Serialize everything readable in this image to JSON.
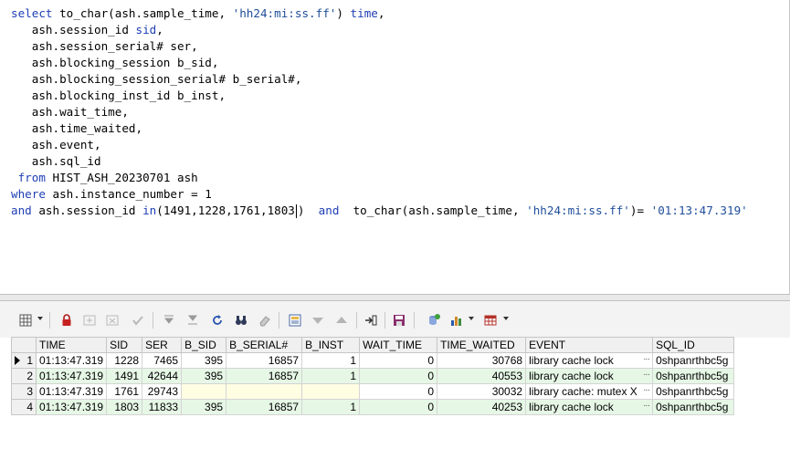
{
  "editor": {
    "lines": [
      {
        "parts": [
          {
            "t": "select",
            "c": "kw"
          },
          {
            "t": " to_char(ash.sample_time, "
          },
          {
            "t": "'hh24:mi:ss.ff'",
            "c": "str"
          },
          {
            "t": ") "
          },
          {
            "t": "time",
            "c": "kw"
          },
          {
            "t": ","
          }
        ]
      },
      {
        "parts": [
          {
            "t": "   ash.session_id "
          },
          {
            "t": "sid",
            "c": "kw"
          },
          {
            "t": ","
          }
        ]
      },
      {
        "parts": [
          {
            "t": "   ash.session_serial# ser,"
          }
        ]
      },
      {
        "parts": [
          {
            "t": "   ash.blocking_session b_sid,"
          }
        ]
      },
      {
        "parts": [
          {
            "t": "   ash.blocking_session_serial# b_serial#,"
          }
        ]
      },
      {
        "parts": [
          {
            "t": "   ash.blocking_inst_id b_inst,"
          }
        ]
      },
      {
        "parts": [
          {
            "t": "   ash.wait_time,"
          }
        ]
      },
      {
        "parts": [
          {
            "t": "   ash.time_waited,"
          }
        ]
      },
      {
        "parts": [
          {
            "t": "   ash.event,"
          }
        ]
      },
      {
        "parts": [
          {
            "t": "   ash.sql_id"
          }
        ]
      },
      {
        "parts": [
          {
            "t": " "
          },
          {
            "t": "from",
            "c": "kw"
          },
          {
            "t": " HIST_ASH_20230701 ash"
          }
        ]
      },
      {
        "parts": [
          {
            "t": "where",
            "c": "kw"
          },
          {
            "t": " ash.instance_number = 1"
          }
        ]
      },
      {
        "parts": [
          {
            "t": "and",
            "c": "kw"
          },
          {
            "t": " ash.session_id "
          },
          {
            "t": "in",
            "c": "kw"
          },
          {
            "t": "(1491,1228,1761,1803"
          },
          {
            "t": "|",
            "c": "caret"
          },
          {
            "t": ")  "
          },
          {
            "t": "and",
            "c": "kw"
          },
          {
            "t": "  to_char(ash.sample_time, "
          },
          {
            "t": "'hh24:mi:ss.ff'",
            "c": "str"
          },
          {
            "t": ")= "
          },
          {
            "t": "'01:13:47.319'",
            "c": "str"
          }
        ]
      }
    ]
  },
  "grid": {
    "columns": [
      "TIME",
      "SID",
      "SER",
      "B_SID",
      "B_SERIAL#",
      "B_INST",
      "WAIT_TIME",
      "TIME_WAITED",
      "EVENT",
      "SQL_ID"
    ],
    "rows": [
      {
        "n": "1",
        "current": true,
        "cells": [
          "01:13:47.319",
          "1228",
          "7465",
          "395",
          "16857",
          "1",
          "0",
          "30768",
          "library cache lock",
          "0shpanrthbc5g"
        ]
      },
      {
        "n": "2",
        "current": false,
        "cells": [
          "01:13:47.319",
          "1491",
          "42644",
          "395",
          "16857",
          "1",
          "0",
          "40553",
          "library cache lock",
          "0shpanrthbc5g"
        ]
      },
      {
        "n": "3",
        "current": false,
        "cells": [
          "01:13:47.319",
          "1761",
          "29743",
          "",
          "",
          "",
          "0",
          "30032",
          "library cache: mutex X",
          "0shpanrthbc5g"
        ]
      },
      {
        "n": "4",
        "current": false,
        "cells": [
          "01:13:47.319",
          "1803",
          "11833",
          "395",
          "16857",
          "1",
          "0",
          "40253",
          "library cache lock",
          "0shpanrthbc5g"
        ]
      }
    ],
    "ellipsis": "···"
  }
}
